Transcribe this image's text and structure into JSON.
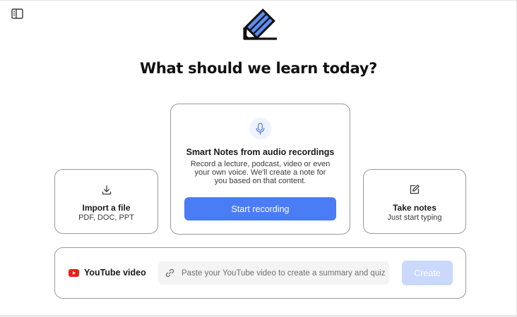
{
  "header": {
    "sidebar_toggle_icon": "sidebar-panel-icon",
    "logo_icon": "pencil-notebook-logo",
    "headline": "What should we learn today?"
  },
  "cards": {
    "import": {
      "icon": "download-icon",
      "title": "Import a file",
      "subtitle": "PDF, DOC, PPT"
    },
    "record": {
      "icon": "microphone-icon",
      "title": "Smart Notes from audio recordings",
      "description_lines": [
        "Record a lecture, podcast, video or even",
        "your own voice. We'll create a note for",
        "you based on that content."
      ],
      "button_label": "Start recording"
    },
    "notes": {
      "icon": "edit-square-icon",
      "title": "Take notes",
      "subtitle": "Just start typing"
    }
  },
  "youtube": {
    "icon": "youtube-icon",
    "label": "YouTube video",
    "link_icon": "link-icon",
    "input_value": "",
    "input_placeholder": "Paste your YouTube video to create a summary and quiz",
    "create_label": "Create",
    "create_enabled": false
  },
  "colors": {
    "accent": "#4a7cf6",
    "accent_disabled": "#c9d8fb",
    "logo_blue": "#5b8def",
    "youtube_red": "#e62117",
    "card_border": "#9a9a9a",
    "input_bg": "#f4f4f5"
  }
}
